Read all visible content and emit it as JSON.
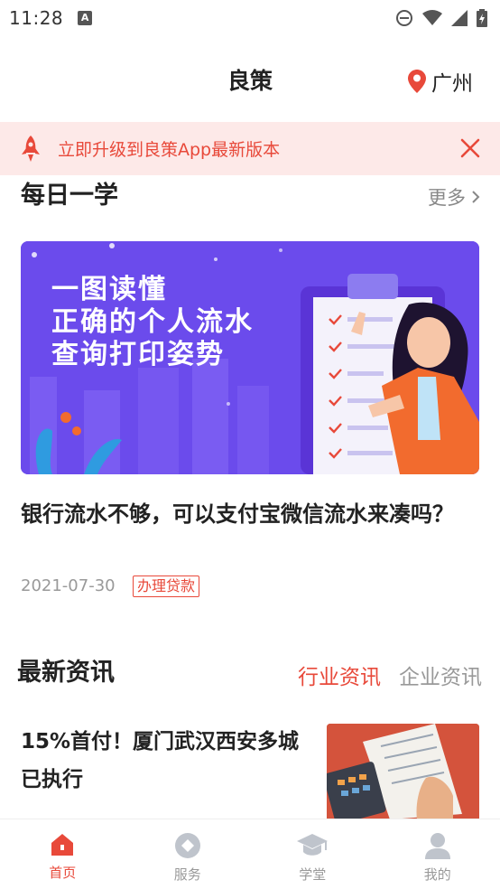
{
  "status_bar": {
    "time": "11:28",
    "notification_icon": "A"
  },
  "header": {
    "title": "良策",
    "location": "广州"
  },
  "banner": {
    "text": "立即升级到良策App最新版本",
    "accent_color": "#e8493a",
    "background": "#fde9e8"
  },
  "daily_learn": {
    "title": "每日一学",
    "more_label": "更多",
    "image_headline": [
      "一图读懂",
      "正确的个人流水",
      "查询打印姿势"
    ],
    "article_title": "银行流水不够，可以支付宝微信流水来凑吗？",
    "date": "2021-07-30",
    "tag": "办理贷款"
  },
  "latest_news": {
    "title": "最新资讯",
    "tabs": [
      {
        "label": "行业资讯",
        "active": true
      },
      {
        "label": "企业资讯",
        "active": false
      }
    ],
    "items": [
      {
        "title": "15%首付！厦门武汉西安多城已执行"
      }
    ]
  },
  "bottom_nav": {
    "items": [
      {
        "label": "首页",
        "icon": "home-icon",
        "active": true
      },
      {
        "label": "服务",
        "icon": "service-icon",
        "active": false
      },
      {
        "label": "学堂",
        "icon": "graduation-cap-icon",
        "active": false
      },
      {
        "label": "我的",
        "icon": "user-icon",
        "active": false
      }
    ]
  }
}
